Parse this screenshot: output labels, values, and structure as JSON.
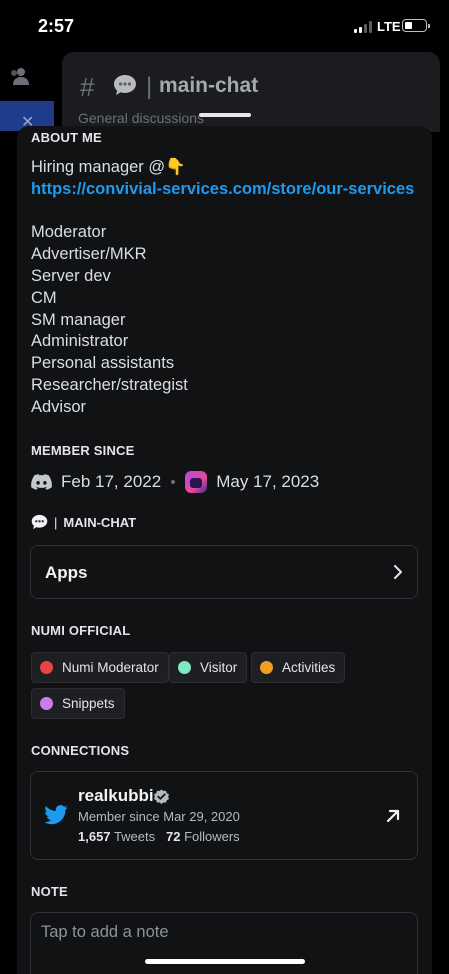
{
  "status_bar": {
    "time": "2:57",
    "network": "LTE"
  },
  "background": {
    "channel_hash": "#",
    "channel_separator": "|",
    "channel_name": "main-chat",
    "channel_topic": "General discussions"
  },
  "about_me": {
    "title": "ABOUT ME",
    "intro": "Hiring manager @👇",
    "link": "https://convivial-services.com/store/our-services",
    "roles_list": [
      "Moderator",
      "Advertiser/MKR",
      "Server dev",
      "CM",
      "SM manager",
      "Administrator",
      "Personal assistants",
      "Researcher/strategist",
      "Advisor"
    ]
  },
  "member_since": {
    "title": "MEMBER SINCE",
    "discord_date": "Feb 17, 2022",
    "server_date": "May 17, 2023"
  },
  "channel": {
    "emoji": "💬",
    "separator": "|",
    "name": "MAIN-CHAT",
    "apps_label": "Apps"
  },
  "roles": {
    "title": "NUMI OFFICIAL",
    "items": [
      {
        "name": "Numi Moderator",
        "color": "#ed4245"
      },
      {
        "name": "Visitor",
        "color": "#7ee8c3"
      },
      {
        "name": "Activities",
        "color": "#f0a020"
      },
      {
        "name": "Snippets",
        "color": "#c77dea"
      }
    ]
  },
  "connections": {
    "title": "CONNECTIONS",
    "account": {
      "service_icon": "twitter-icon",
      "username": "realkubbi",
      "member_since": "Member since Mar 29, 2020",
      "tweets_count": "1,657",
      "tweets_label": "Tweets",
      "followers_count": "72",
      "followers_label": "Followers"
    }
  },
  "note": {
    "title": "NOTE",
    "placeholder": "Tap to add a note"
  },
  "colors": {
    "sheet_bg": "#111214",
    "link": "#1d9bf0",
    "twitter": "#1d9bf0"
  }
}
